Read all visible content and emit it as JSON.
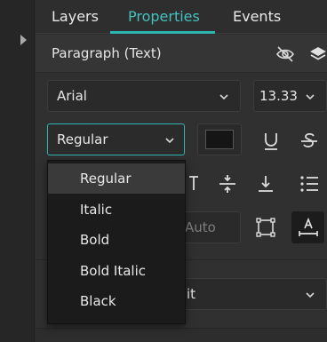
{
  "tabs": [
    {
      "label": "Layers"
    },
    {
      "label": "Properties",
      "active": true
    },
    {
      "label": "Events"
    }
  ],
  "accent_color": "#2fb5b0",
  "section": {
    "title": "Paragraph (Text)"
  },
  "font": {
    "family": "Arial",
    "size": "13.33",
    "style": "Regular",
    "color": "#151515"
  },
  "auto_field": {
    "value": "Auto"
  },
  "bottom_select": {
    "value": "it"
  },
  "style_dropdown": {
    "options": [
      "Regular",
      "Italic",
      "Bold",
      "Bold Italic",
      "Black"
    ],
    "highlighted": "Regular"
  }
}
